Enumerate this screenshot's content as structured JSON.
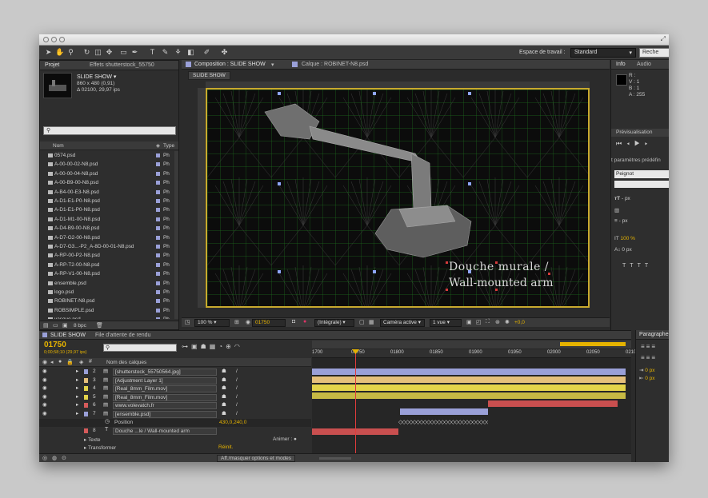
{
  "toolbar": {
    "workspace_label": "Espace de travail :",
    "workspace_value": "Standard",
    "search_placeholder": "Reche"
  },
  "project": {
    "tab_label": "Projet",
    "effects_tab_label": "Effets shutterstock_55750",
    "comp_name": "SLIDE SHOW ▾",
    "comp_size": "860 x 480 (0,91)",
    "comp_duration": "Δ 02100, 29,97 ips",
    "col_name": "Nom",
    "col_type": "Type",
    "bpc": "8 bpc",
    "files": [
      {
        "name": "0574.psd",
        "type": "Ph"
      },
      {
        "name": "A-00-00-02-N8.psd",
        "type": "Ph"
      },
      {
        "name": "A-00-00-04-N8.psd",
        "type": "Ph"
      },
      {
        "name": "A-00-B9-00-N8.psd",
        "type": "Ph"
      },
      {
        "name": "A-B4-00-E3-N8.psd",
        "type": "Ph"
      },
      {
        "name": "A-D1-E1-P0-N8.psd",
        "type": "Ph"
      },
      {
        "name": "A-D1-E1-P0-N8.psd",
        "type": "Ph"
      },
      {
        "name": "A-D1-M1-00-N8.psd",
        "type": "Ph"
      },
      {
        "name": "A-D4-B9-00-N8.psd",
        "type": "Ph"
      },
      {
        "name": "A-D7-G2-00-N8.psd",
        "type": "Ph"
      },
      {
        "name": "A-D7-G3...-P2_A-8D-00-01-N8.psd",
        "type": "Ph"
      },
      {
        "name": "A-RP-00-P2-N8.psd",
        "type": "Ph"
      },
      {
        "name": "A-RP-T2-00-N8.psd",
        "type": "Ph"
      },
      {
        "name": "A-RP-V1-00-N8.psd",
        "type": "Ph"
      },
      {
        "name": "ensemble.psd",
        "type": "Ph"
      },
      {
        "name": "logo.psd",
        "type": "Ph"
      },
      {
        "name": "ROBINET-N8.psd",
        "type": "Ph"
      },
      {
        "name": "ROBSIMPLE.psd",
        "type": "Ph"
      },
      {
        "name": "vasque.psd",
        "type": "Ph"
      }
    ]
  },
  "composition": {
    "tab_label": "Composition : SLIDE SHOW",
    "layer_tab_label": "Calque : ROBINET-N8.psd",
    "crumb": "SLIDE SHOW",
    "overlay_title_line1": "Douche murale /",
    "overlay_title_line2": "Wall-mounted arm",
    "zoom": "100 %",
    "timecode": "01750",
    "resolution": "(Intégrale)",
    "camera": "Caméra active",
    "views": "1 vue",
    "exposure": "+0,0"
  },
  "info": {
    "tab_label": "Info",
    "audio_tab": "Audio",
    "r": "R :",
    "v": "V : 1",
    "b": "B : 1",
    "a": "A : 255",
    "preview_tab": "Prévisualisation",
    "presets_label": "t paramètres prédéfin",
    "font": "Peignot",
    "px1": "- px",
    "px2": "- px",
    "scale": "100 %",
    "px3": "0 px"
  },
  "timeline": {
    "tab_label": "SLIDE SHOW",
    "queue_tab": "File d'attente de rendu",
    "timecode": "01750",
    "timecode_sub": "0;00;58;10 (29,97 ips)",
    "col_layer_name": "Nom des calques",
    "ruler": [
      "1700",
      "01750",
      "01800",
      "01850",
      "01900",
      "01950",
      "02000",
      "02050",
      "0210"
    ],
    "layers": [
      {
        "num": "2",
        "name": "[shutterstock_55750564.jpg]",
        "color": "#9aa0d8"
      },
      {
        "num": "3",
        "name": "[Adjustment Layer 1]",
        "color": "#e5c07b"
      },
      {
        "num": "4",
        "name": "[Real_8mm_Film.mov]",
        "color": "#e3d34a"
      },
      {
        "num": "5",
        "name": "[Real_8mm_Film.mov]",
        "color": "#e3d34a"
      },
      {
        "num": "6",
        "name": "www.volevatch.fr",
        "color": "#d65b5b"
      },
      {
        "num": "7",
        "name": "[ensemble.psd]",
        "color": "#9aa0d8"
      }
    ],
    "position_label": "Position",
    "position_value": "430,0,240,0",
    "layer8_num": "8",
    "layer8_name": "Douche ...le  /  Wall-mounted arm",
    "text_group": "Texte",
    "animate": "Animer : ●",
    "transform_group": "Transformer",
    "reset": "Réinit.",
    "toggle_modes": "Aff./masquer options et modes"
  },
  "paragraph": {
    "tab_label": "Paragraphe",
    "px_a": "0 px",
    "px_b": "0 px"
  }
}
